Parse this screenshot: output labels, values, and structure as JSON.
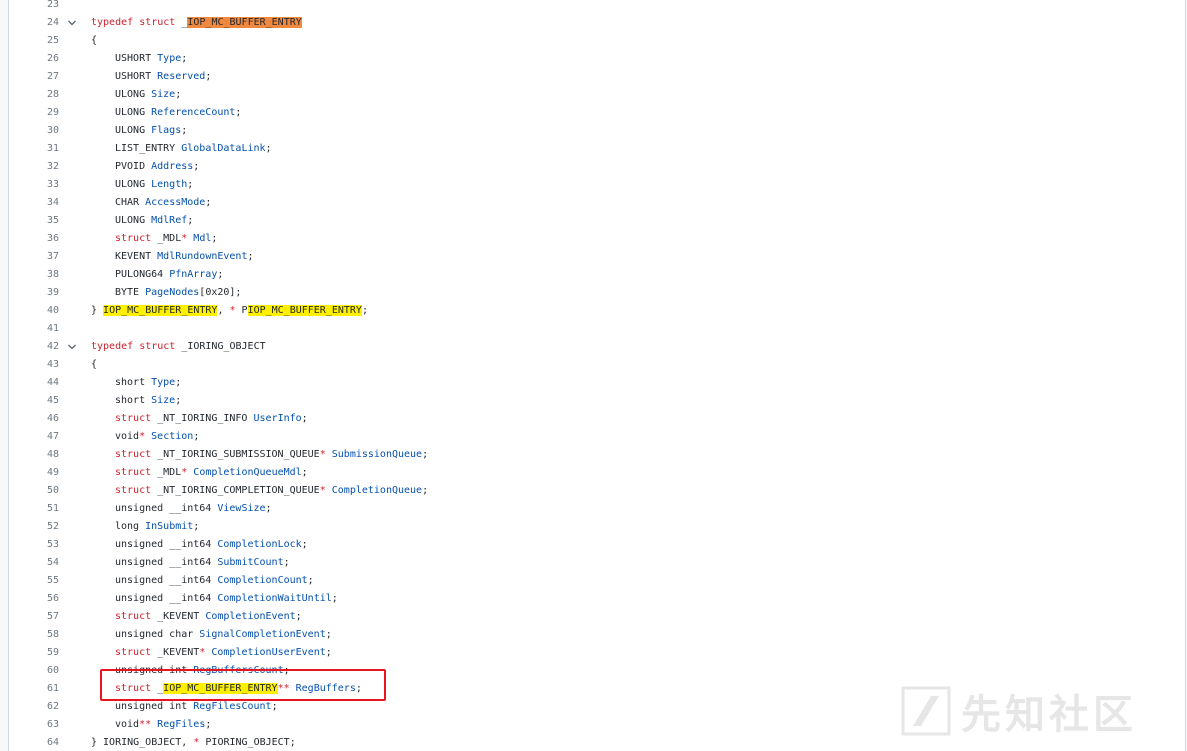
{
  "watermark": {
    "text": "先知社区"
  },
  "colors": {
    "keyword": "#cf222e",
    "identifier": "#0550ae",
    "highlight": "#fff000",
    "highlight_current": "#f0883e",
    "annotation_box": "#e8141f"
  },
  "lines": [
    {
      "n": "23",
      "fold": false,
      "indent": 0,
      "tokens": []
    },
    {
      "n": "24",
      "fold": true,
      "indent": 0,
      "tokens": [
        {
          "t": "typedef",
          "c": "kw"
        },
        {
          "t": " "
        },
        {
          "t": "struct",
          "c": "kw"
        },
        {
          "t": " _"
        },
        {
          "t": "IOP_MC_BUFFER_ENTRY",
          "c": "ty",
          "h": "o"
        }
      ]
    },
    {
      "n": "25",
      "fold": false,
      "indent": 0,
      "tokens": [
        {
          "t": "{"
        }
      ]
    },
    {
      "n": "26",
      "fold": false,
      "indent": 1,
      "tokens": [
        {
          "t": "USHORT "
        },
        {
          "t": "Type",
          "c": "id"
        },
        {
          "t": ";"
        }
      ]
    },
    {
      "n": "27",
      "fold": false,
      "indent": 1,
      "tokens": [
        {
          "t": "USHORT "
        },
        {
          "t": "Reserved",
          "c": "id"
        },
        {
          "t": ";"
        }
      ]
    },
    {
      "n": "28",
      "fold": false,
      "indent": 1,
      "tokens": [
        {
          "t": "ULONG "
        },
        {
          "t": "Size",
          "c": "id"
        },
        {
          "t": ";"
        }
      ]
    },
    {
      "n": "29",
      "fold": false,
      "indent": 1,
      "tokens": [
        {
          "t": "ULONG "
        },
        {
          "t": "ReferenceCount",
          "c": "id"
        },
        {
          "t": ";"
        }
      ]
    },
    {
      "n": "30",
      "fold": false,
      "indent": 1,
      "tokens": [
        {
          "t": "ULONG "
        },
        {
          "t": "Flags",
          "c": "id"
        },
        {
          "t": ";"
        }
      ]
    },
    {
      "n": "31",
      "fold": false,
      "indent": 1,
      "tokens": [
        {
          "t": "LIST_ENTRY "
        },
        {
          "t": "GlobalDataLink",
          "c": "id"
        },
        {
          "t": ";"
        }
      ]
    },
    {
      "n": "32",
      "fold": false,
      "indent": 1,
      "tokens": [
        {
          "t": "PVOID "
        },
        {
          "t": "Address",
          "c": "id"
        },
        {
          "t": ";"
        }
      ]
    },
    {
      "n": "33",
      "fold": false,
      "indent": 1,
      "tokens": [
        {
          "t": "ULONG "
        },
        {
          "t": "Length",
          "c": "id"
        },
        {
          "t": ";"
        }
      ]
    },
    {
      "n": "34",
      "fold": false,
      "indent": 1,
      "tokens": [
        {
          "t": "CHAR "
        },
        {
          "t": "AccessMode",
          "c": "id"
        },
        {
          "t": ";"
        }
      ]
    },
    {
      "n": "35",
      "fold": false,
      "indent": 1,
      "tokens": [
        {
          "t": "ULONG "
        },
        {
          "t": "MdlRef",
          "c": "id"
        },
        {
          "t": ";"
        }
      ]
    },
    {
      "n": "36",
      "fold": false,
      "indent": 1,
      "tokens": [
        {
          "t": "struct",
          "c": "kw"
        },
        {
          "t": " _MDL"
        },
        {
          "t": "*",
          "c": "kw"
        },
        {
          "t": " "
        },
        {
          "t": "Mdl",
          "c": "id"
        },
        {
          "t": ";"
        }
      ]
    },
    {
      "n": "37",
      "fold": false,
      "indent": 1,
      "tokens": [
        {
          "t": "KEVENT "
        },
        {
          "t": "MdlRundownEvent",
          "c": "id"
        },
        {
          "t": ";"
        }
      ]
    },
    {
      "n": "38",
      "fold": false,
      "indent": 1,
      "tokens": [
        {
          "t": "PULONG64 "
        },
        {
          "t": "PfnArray",
          "c": "id"
        },
        {
          "t": ";"
        }
      ]
    },
    {
      "n": "39",
      "fold": false,
      "indent": 1,
      "tokens": [
        {
          "t": "BYTE "
        },
        {
          "t": "PageNodes",
          "c": "id"
        },
        {
          "t": "[0x20];"
        }
      ]
    },
    {
      "n": "40",
      "fold": false,
      "indent": 0,
      "tokens": [
        {
          "t": "} "
        },
        {
          "t": "IOP_MC_BUFFER_ENTRY",
          "h": "y"
        },
        {
          "t": ", "
        },
        {
          "t": "*",
          "c": "kw"
        },
        {
          "t": " P"
        },
        {
          "t": "IOP_MC_BUFFER_ENTRY",
          "h": "y"
        },
        {
          "t": ";"
        }
      ]
    },
    {
      "n": "41",
      "fold": false,
      "indent": 0,
      "tokens": []
    },
    {
      "n": "42",
      "fold": true,
      "indent": 0,
      "tokens": [
        {
          "t": "typedef",
          "c": "kw"
        },
        {
          "t": " "
        },
        {
          "t": "struct",
          "c": "kw"
        },
        {
          "t": " _IORING_OBJECT"
        }
      ]
    },
    {
      "n": "43",
      "fold": false,
      "indent": 0,
      "tokens": [
        {
          "t": "{"
        }
      ]
    },
    {
      "n": "44",
      "fold": false,
      "indent": 1,
      "tokens": [
        {
          "t": "short "
        },
        {
          "t": "Type",
          "c": "id"
        },
        {
          "t": ";"
        }
      ]
    },
    {
      "n": "45",
      "fold": false,
      "indent": 1,
      "tokens": [
        {
          "t": "short "
        },
        {
          "t": "Size",
          "c": "id"
        },
        {
          "t": ";"
        }
      ]
    },
    {
      "n": "46",
      "fold": false,
      "indent": 1,
      "tokens": [
        {
          "t": "struct",
          "c": "kw"
        },
        {
          "t": " _NT_IORING_INFO "
        },
        {
          "t": "UserInfo",
          "c": "id"
        },
        {
          "t": ";"
        }
      ]
    },
    {
      "n": "47",
      "fold": false,
      "indent": 1,
      "tokens": [
        {
          "t": "void"
        },
        {
          "t": "*",
          "c": "kw"
        },
        {
          "t": " "
        },
        {
          "t": "Section",
          "c": "id"
        },
        {
          "t": ";"
        }
      ]
    },
    {
      "n": "48",
      "fold": false,
      "indent": 1,
      "tokens": [
        {
          "t": "struct",
          "c": "kw"
        },
        {
          "t": " _NT_IORING_SUBMISSION_QUEUE"
        },
        {
          "t": "*",
          "c": "kw"
        },
        {
          "t": " "
        },
        {
          "t": "SubmissionQueue",
          "c": "id"
        },
        {
          "t": ";"
        }
      ]
    },
    {
      "n": "49",
      "fold": false,
      "indent": 1,
      "tokens": [
        {
          "t": "struct",
          "c": "kw"
        },
        {
          "t": " _MDL"
        },
        {
          "t": "*",
          "c": "kw"
        },
        {
          "t": " "
        },
        {
          "t": "CompletionQueueMdl",
          "c": "id"
        },
        {
          "t": ";"
        }
      ]
    },
    {
      "n": "50",
      "fold": false,
      "indent": 1,
      "tokens": [
        {
          "t": "struct",
          "c": "kw"
        },
        {
          "t": " _NT_IORING_COMPLETION_QUEUE"
        },
        {
          "t": "*",
          "c": "kw"
        },
        {
          "t": " "
        },
        {
          "t": "CompletionQueue",
          "c": "id"
        },
        {
          "t": ";"
        }
      ]
    },
    {
      "n": "51",
      "fold": false,
      "indent": 1,
      "tokens": [
        {
          "t": "unsigned __int64 "
        },
        {
          "t": "ViewSize",
          "c": "id"
        },
        {
          "t": ";"
        }
      ]
    },
    {
      "n": "52",
      "fold": false,
      "indent": 1,
      "tokens": [
        {
          "t": "long "
        },
        {
          "t": "InSubmit",
          "c": "id"
        },
        {
          "t": ";"
        }
      ]
    },
    {
      "n": "53",
      "fold": false,
      "indent": 1,
      "tokens": [
        {
          "t": "unsigned __int64 "
        },
        {
          "t": "CompletionLock",
          "c": "id"
        },
        {
          "t": ";"
        }
      ]
    },
    {
      "n": "54",
      "fold": false,
      "indent": 1,
      "tokens": [
        {
          "t": "unsigned __int64 "
        },
        {
          "t": "SubmitCount",
          "c": "id"
        },
        {
          "t": ";"
        }
      ]
    },
    {
      "n": "55",
      "fold": false,
      "indent": 1,
      "tokens": [
        {
          "t": "unsigned __int64 "
        },
        {
          "t": "CompletionCount",
          "c": "id"
        },
        {
          "t": ";"
        }
      ]
    },
    {
      "n": "56",
      "fold": false,
      "indent": 1,
      "tokens": [
        {
          "t": "unsigned __int64 "
        },
        {
          "t": "CompletionWaitUntil",
          "c": "id"
        },
        {
          "t": ";"
        }
      ]
    },
    {
      "n": "57",
      "fold": false,
      "indent": 1,
      "tokens": [
        {
          "t": "struct",
          "c": "kw"
        },
        {
          "t": " _KEVENT "
        },
        {
          "t": "CompletionEvent",
          "c": "id"
        },
        {
          "t": ";"
        }
      ]
    },
    {
      "n": "58",
      "fold": false,
      "indent": 1,
      "tokens": [
        {
          "t": "unsigned char "
        },
        {
          "t": "SignalCompletionEvent",
          "c": "id"
        },
        {
          "t": ";"
        }
      ]
    },
    {
      "n": "59",
      "fold": false,
      "indent": 1,
      "tokens": [
        {
          "t": "struct",
          "c": "kw"
        },
        {
          "t": " _KEVENT"
        },
        {
          "t": "*",
          "c": "kw"
        },
        {
          "t": " "
        },
        {
          "t": "CompletionUserEvent",
          "c": "id"
        },
        {
          "t": ";"
        }
      ]
    },
    {
      "n": "60",
      "fold": false,
      "indent": 1,
      "tokens": [
        {
          "t": "unsigned int "
        },
        {
          "t": "RegBuffersCount",
          "c": "id"
        },
        {
          "t": ";"
        }
      ]
    },
    {
      "n": "61",
      "fold": false,
      "indent": 1,
      "tokens": [
        {
          "t": "struct",
          "c": "kw"
        },
        {
          "t": " _"
        },
        {
          "t": "IOP_MC_BUFFER_ENTRY",
          "h": "y"
        },
        {
          "t": "**",
          "c": "kw"
        },
        {
          "t": " "
        },
        {
          "t": "RegBuffers",
          "c": "id"
        },
        {
          "t": ";"
        }
      ]
    },
    {
      "n": "62",
      "fold": false,
      "indent": 1,
      "tokens": [
        {
          "t": "unsigned int "
        },
        {
          "t": "RegFilesCount",
          "c": "id"
        },
        {
          "t": ";"
        }
      ]
    },
    {
      "n": "63",
      "fold": false,
      "indent": 1,
      "tokens": [
        {
          "t": "void"
        },
        {
          "t": "**",
          "c": "kw"
        },
        {
          "t": " "
        },
        {
          "t": "RegFiles",
          "c": "id"
        },
        {
          "t": ";"
        }
      ]
    },
    {
      "n": "64",
      "fold": false,
      "indent": 0,
      "tokens": [
        {
          "t": "} IORING_OBJECT, "
        },
        {
          "t": "*",
          "c": "kw"
        },
        {
          "t": " PIORING_OBJECT;"
        }
      ]
    }
  ]
}
